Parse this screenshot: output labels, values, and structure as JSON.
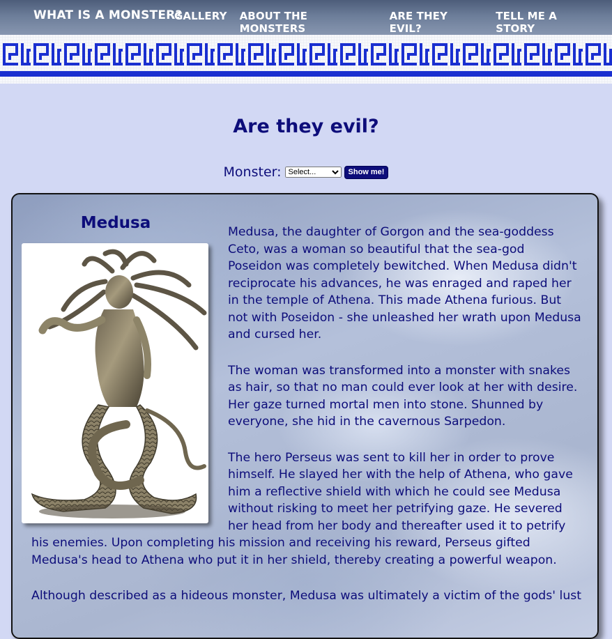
{
  "header": {
    "brand": "WHAT IS A MONSTER?",
    "nav": [
      "GALLERY",
      "ABOUT THE MONSTERS",
      "ARE THEY EVIL?",
      "TELL ME A STORY"
    ]
  },
  "page": {
    "title": "Are they evil?"
  },
  "selector": {
    "label": "Monster:",
    "selected": "Select...",
    "button": "Show me!"
  },
  "monster": {
    "name": "Medusa",
    "image_icon": "medusa-statue-image",
    "paragraphs": [
      "Medusa, the daughter of Gorgon and the sea-goddess Ceto, was a woman so beautiful that the sea-god Poseidon was completely bewitched. When Medusa didn't reciprocate his advances, he was enraged and raped her in the temple of Athena. This made Athena furious. But not with Poseidon - she unleashed her wrath upon Medusa and cursed her.",
      "The woman was transformed into a monster with snakes as hair, so that no man could ever look at her with desire. Her gaze turned mortal men into stone. Shunned by everyone, she hid in the cavernous Sarpedon.",
      "The hero Perseus was sent to kill her in order to prove himself. He slayed her with the help of Athena, who gave him a reflective shield with which he could see Medusa without risking to meet her petrifying gaze. He severed her head from her body and thereafter used it to petrify his enemies. Upon completing his mission and receiving his reward, Perseus gifted Medusa's head to Athena who put it in her shield, thereby creating a powerful weapon.",
      "Although described as a hideous monster, Medusa was ultimately a victim of the gods' lust"
    ]
  },
  "colors": {
    "accent": "#0d0d7a",
    "meander": "#1a2fd0",
    "background": "#d2d8f4"
  }
}
